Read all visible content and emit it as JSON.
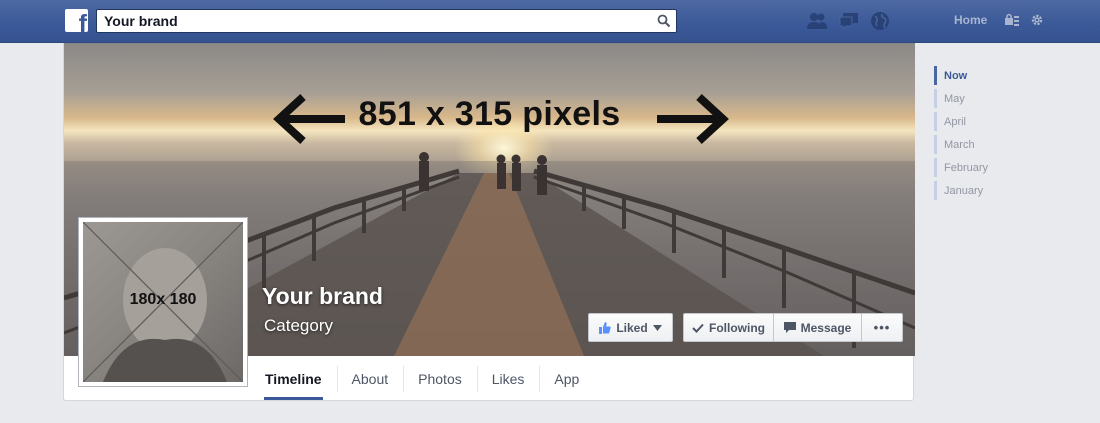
{
  "topbar": {
    "logo": "f",
    "search_value": "Your brand",
    "search_icon": "search-icon",
    "jewels": [
      "friend-requests-icon",
      "messages-icon",
      "notifications-icon"
    ],
    "home_label": "Home",
    "privacy_icon": "privacy-shortcuts-icon",
    "settings_icon": "gear-icon"
  },
  "cover": {
    "dimension_label": "851 x 315 pixels"
  },
  "profile": {
    "dimension_label": "180x 180",
    "name": "Your brand",
    "category": "Category"
  },
  "actions": {
    "liked_label": "Liked",
    "following_label": "Following",
    "message_label": "Message",
    "more_label": "•••"
  },
  "tabs": [
    {
      "label": "Timeline",
      "active": true
    },
    {
      "label": "About"
    },
    {
      "label": "Photos"
    },
    {
      "label": "Likes"
    },
    {
      "label": "App"
    }
  ],
  "scrubber": [
    {
      "label": "Now",
      "active": true
    },
    {
      "label": "May"
    },
    {
      "label": "April"
    },
    {
      "label": "March"
    },
    {
      "label": "February"
    },
    {
      "label": "January"
    }
  ],
  "colors": {
    "brand_blue": "#3b5998",
    "topbar_blue": "#4e69a2",
    "page_bg": "#e9eaed"
  }
}
